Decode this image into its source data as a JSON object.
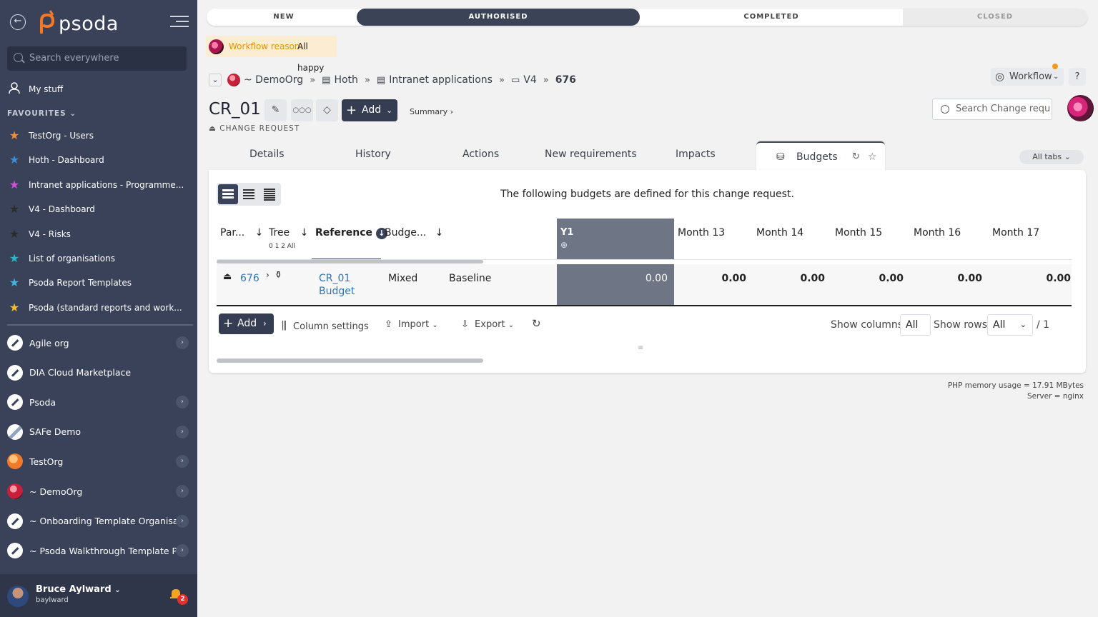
{
  "sidebar": {
    "logo_text": "psoda",
    "search_placeholder": "Search everywhere",
    "my_stuff": "My stuff",
    "favourites_label": "FAVOURITES",
    "favourites": [
      {
        "label": "TestOrg - Users",
        "color": "#f28c38"
      },
      {
        "label": "Hoth - Dashboard",
        "color": "#3a8fd9"
      },
      {
        "label": "Intranet applications - Programme...",
        "color": "#d64fd8"
      },
      {
        "label": "V4 - Dashboard",
        "color": "#2b2b2b"
      },
      {
        "label": "V4 - Risks",
        "color": "#2b2b2b"
      },
      {
        "label": "List of organisations",
        "color": "#2bb6c9"
      },
      {
        "label": "Psoda Report Templates",
        "color": "#3fb6e0"
      },
      {
        "label": "Psoda (standard reports and work...",
        "color": "#f2c01e"
      }
    ],
    "orgs": [
      {
        "label": "Agile org",
        "arrow": true
      },
      {
        "label": "DIA Cloud Marketplace",
        "arrow": false
      },
      {
        "label": "Psoda",
        "arrow": true
      },
      {
        "label": "SAFe Demo",
        "arrow": true
      },
      {
        "label": "TestOrg",
        "arrow": true
      },
      {
        "label": "~ DemoOrg",
        "arrow": true
      },
      {
        "label": "~ Onboarding Template Organisa...",
        "arrow": true
      },
      {
        "label": "~ Psoda Walkthrough Template P...",
        "arrow": true
      }
    ],
    "user": {
      "name": "Bruce Aylward",
      "username": "baylward",
      "notifications": "2"
    }
  },
  "progress": {
    "stages": [
      "NEW",
      "AUTHORISED",
      "COMPLETED",
      "CLOSED"
    ],
    "active": "AUTHORISED"
  },
  "workflow_reason": {
    "label": "Workflow reason:",
    "value": "All happy"
  },
  "breadcrumb": [
    "~ DemoOrg",
    "Hoth",
    "Intranet applications",
    "V4",
    "676"
  ],
  "page": {
    "title": "CR_01",
    "add_label": "Add",
    "summary_label": "Summary",
    "type_label": "CHANGE REQUEST",
    "workflow_button": "Workflow",
    "help": "?",
    "search_placeholder": "Search Change requ"
  },
  "tabs": [
    "Details",
    "History",
    "Actions",
    "New requirements",
    "Impacts",
    "Budgets"
  ],
  "active_tab": "Budgets",
  "all_tabs": "All tabs",
  "budgets": {
    "intro": "The following budgets are defined for this change request.",
    "columns": [
      "Par...",
      "Tree",
      "Reference",
      "Budge...",
      "Y1",
      "Month 13",
      "Month 14",
      "Month 15",
      "Month 16",
      "Month 17"
    ],
    "tree_levels": "0 1 2 All",
    "row": {
      "parent": "676",
      "reference_line1": "CR_01",
      "reference_line2": "Budget",
      "budget_type": "Mixed",
      "baseline": "Baseline",
      "values": [
        "0.00",
        "0.00",
        "0.00",
        "0.00",
        "0.00",
        "0.00"
      ]
    },
    "toolbar": {
      "add": "Add",
      "column_settings": "Column settings",
      "import": "Import",
      "export": "Export",
      "show_columns_label": "Show columns:",
      "show_columns_value": "All",
      "show_rows_label": "Show rows:",
      "show_rows_value": "All",
      "pages": "/ 1"
    }
  },
  "footer": {
    "memory": "PHP memory usage = 17.91 MBytes",
    "server": "Server = nginx"
  }
}
